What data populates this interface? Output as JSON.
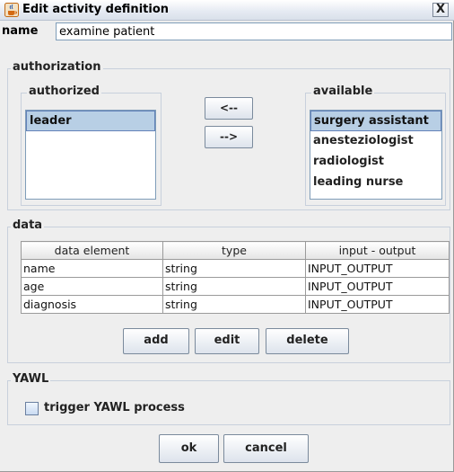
{
  "window": {
    "title": "Edit activity definition",
    "close_glyph": "X"
  },
  "name": {
    "label": "name",
    "value": "examine patient"
  },
  "authorization": {
    "title": "authorization",
    "authorized": {
      "title": "authorized",
      "items": [
        "leader"
      ],
      "selected_index": 0
    },
    "available": {
      "title": "available",
      "items": [
        "surgery assistant",
        "anesteziologist",
        "radiologist",
        "leading nurse"
      ],
      "selected_index": 0
    },
    "move_left_label": "<--",
    "move_right_label": "-->"
  },
  "data": {
    "title": "data",
    "columns": [
      "data element",
      "type",
      "input - output"
    ],
    "rows": [
      [
        "name",
        "string",
        "INPUT_OUTPUT"
      ],
      [
        "age",
        "string",
        "INPUT_OUTPUT"
      ],
      [
        "diagnosis",
        "string",
        "INPUT_OUTPUT"
      ]
    ],
    "add_label": "add",
    "edit_label": "edit",
    "delete_label": "delete"
  },
  "yawl": {
    "title": "YAWL",
    "trigger_label": "trigger YAWL process",
    "trigger_checked": false
  },
  "footer": {
    "ok_label": "ok",
    "cancel_label": "cancel"
  }
}
